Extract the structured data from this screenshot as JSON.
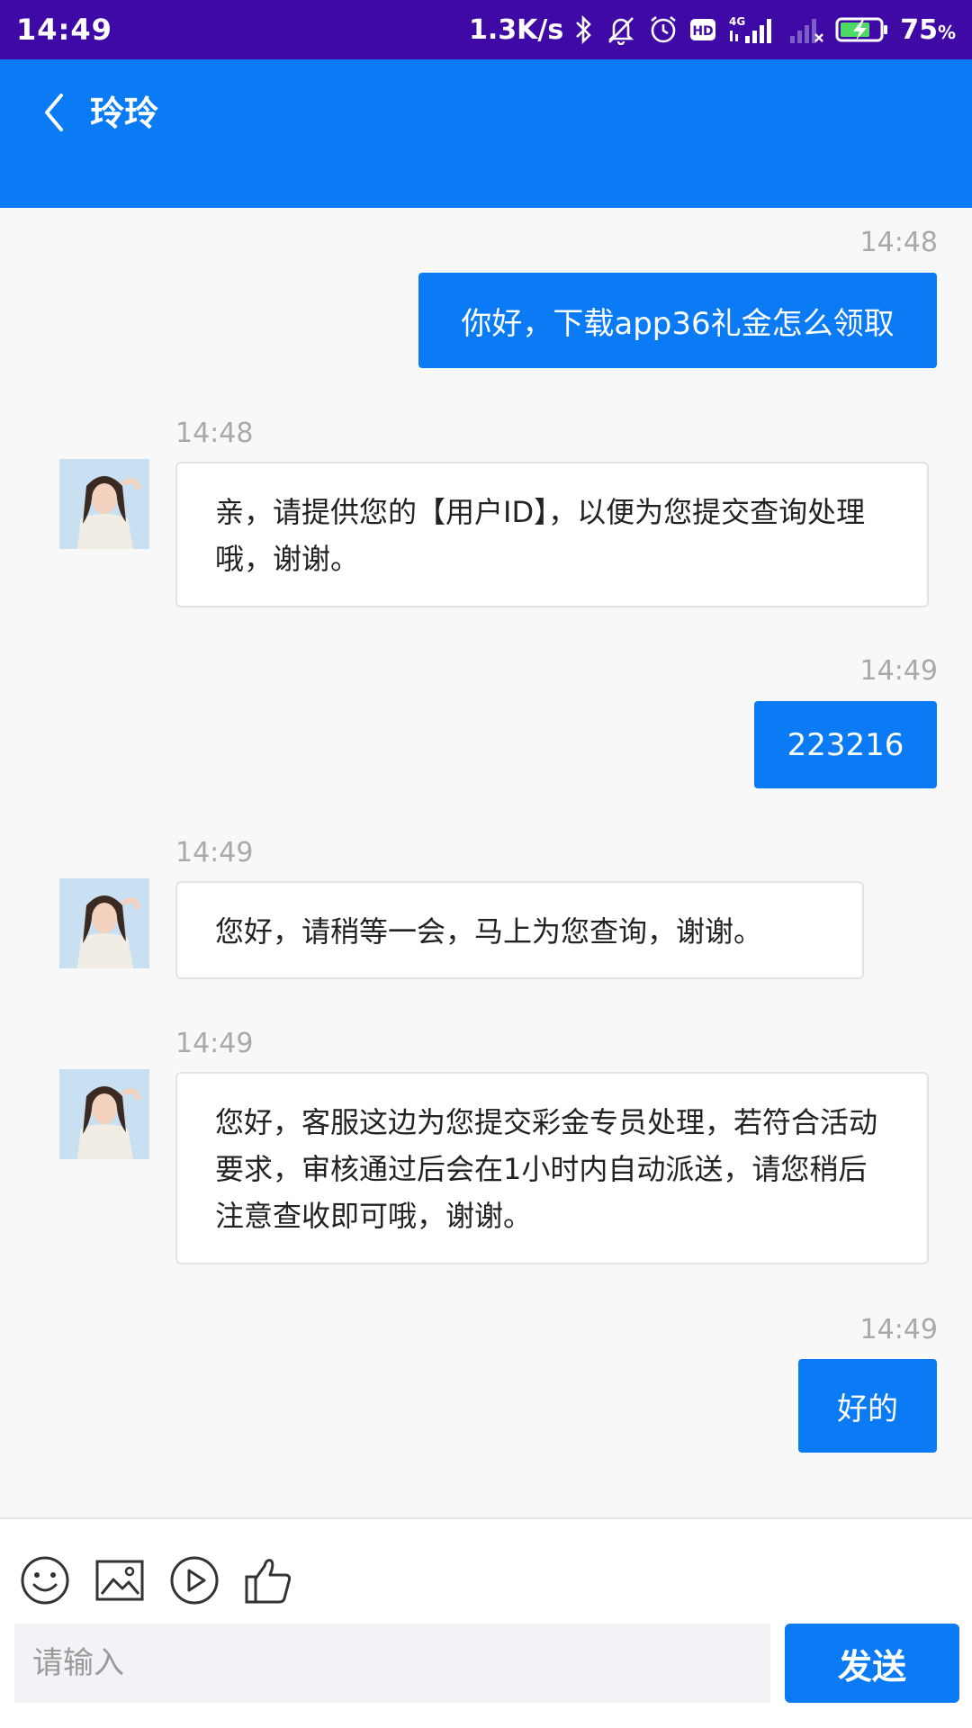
{
  "status_bar": {
    "time": "14:49",
    "net_speed": "1.3K/s",
    "battery_pct": "75",
    "battery_unit": "%",
    "icons": [
      "bluetooth-icon",
      "mute-icon",
      "alarm-icon",
      "hd-icon",
      "4g-signal-icon",
      "no-signal-icon",
      "battery-charging-icon"
    ]
  },
  "header": {
    "title": "玲玲",
    "back_icon": "chevron-left-icon"
  },
  "messages": [
    {
      "side": "out",
      "time": "14:48",
      "text": "你好，下载app36礼金怎么领取"
    },
    {
      "side": "in",
      "time": "14:48",
      "text": "亲，请提供您的【用户ID】，以便为您提交查询处理哦，谢谢。"
    },
    {
      "side": "out",
      "time": "14:49",
      "text": "223216"
    },
    {
      "side": "in",
      "time": "14:49",
      "text": "您好，请稍等一会，马上为您查询，谢谢。"
    },
    {
      "side": "in",
      "time": "14:49",
      "text": "您好，客服这边为您提交彩金专员处理，若符合活动要求，审核通过后会在1小时内自动派送，请您稍后注意查收即可哦，谢谢。"
    },
    {
      "side": "out",
      "time": "14:49",
      "text": "好的"
    }
  ],
  "toolbar": {
    "icons": [
      "emoji-icon",
      "image-icon",
      "video-play-icon",
      "thumbs-up-icon"
    ]
  },
  "input": {
    "placeholder": "请输入",
    "send_label": "发送"
  },
  "colors": {
    "status_bar": "#3f09a6",
    "accent": "#0a7bf5"
  }
}
